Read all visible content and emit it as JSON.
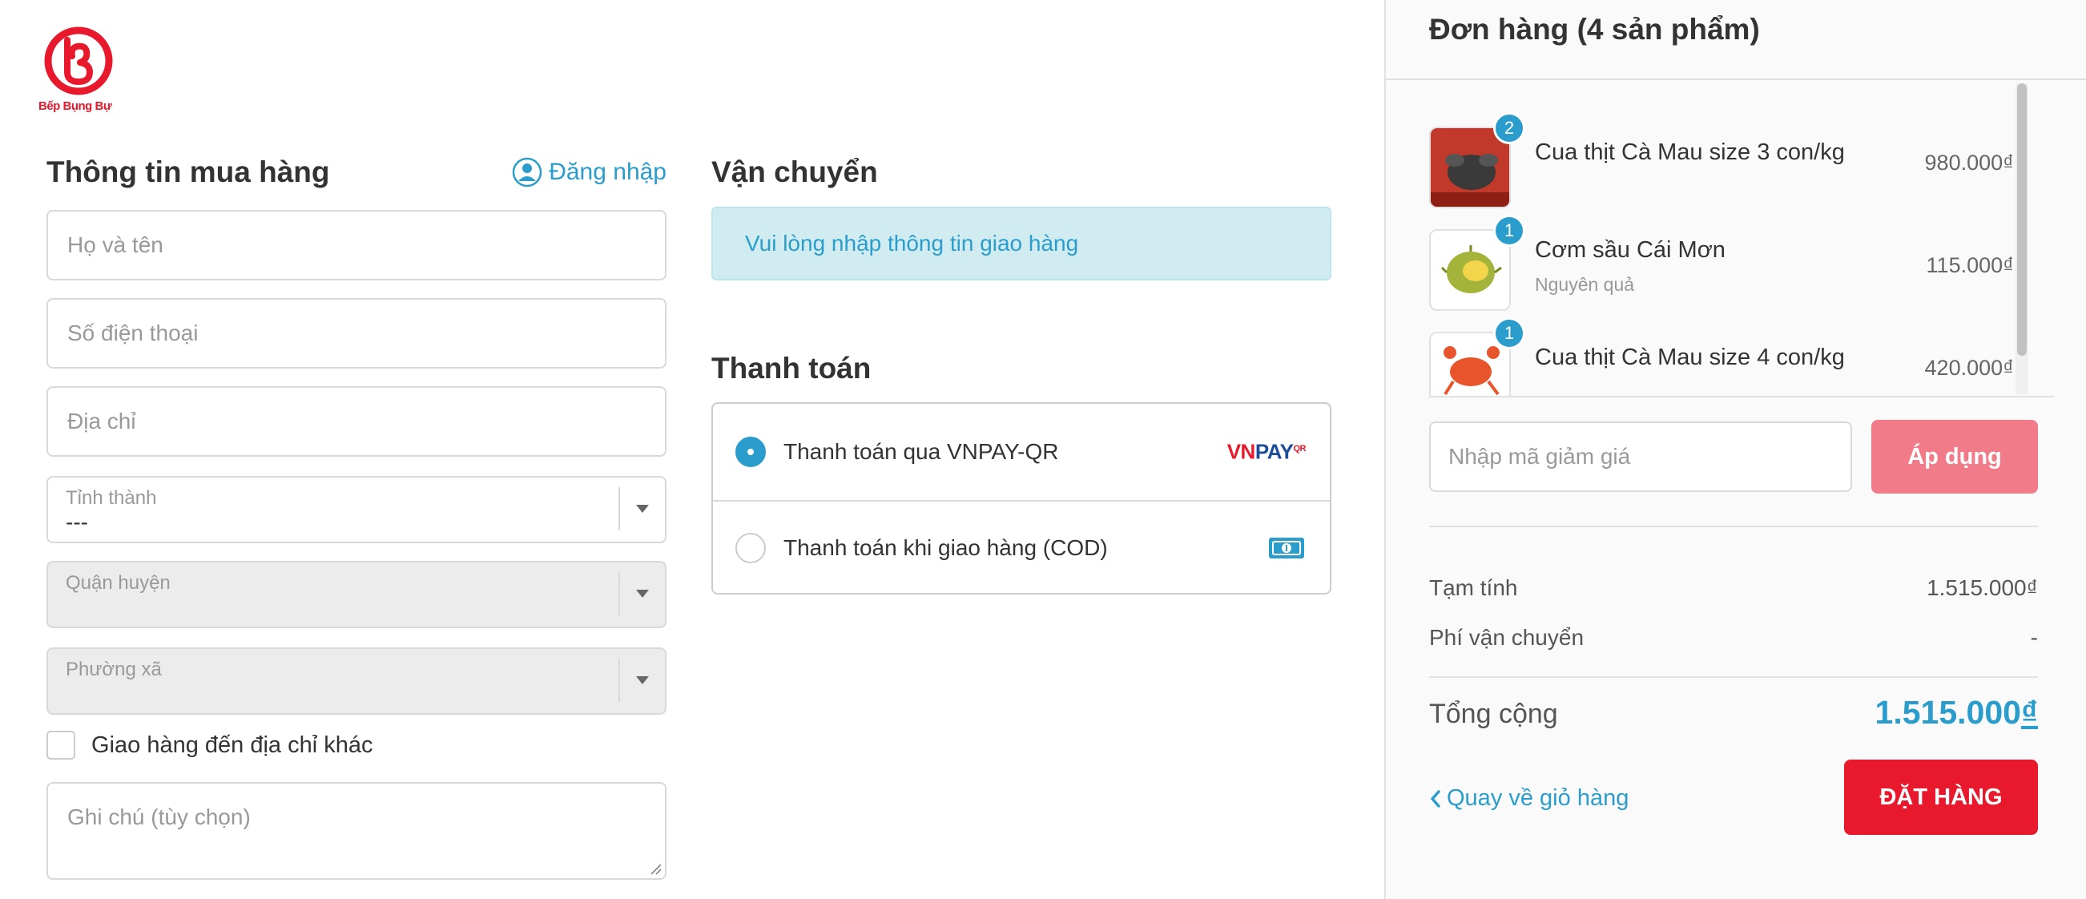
{
  "brand": {
    "logo_text": "Bếp Bụng Bự",
    "accent_color": "#e8192c",
    "link_color": "#2a9dcc"
  },
  "customer_info": {
    "title": "Thông tin mua hàng",
    "login_label": "Đăng nhập",
    "fullname_placeholder": "Họ và tên",
    "phone_placeholder": "Số điện thoại",
    "address_placeholder": "Địa chỉ",
    "province": {
      "label": "Tỉnh thành",
      "value": "---"
    },
    "district": {
      "label": "Quận huyện",
      "value": ""
    },
    "ward": {
      "label": "Phường xã",
      "value": ""
    },
    "ship_other_label": "Giao hàng đến địa chỉ khác",
    "note_placeholder": "Ghi chú (tùy chọn)"
  },
  "shipping": {
    "title": "Vận chuyển",
    "notice": "Vui lòng nhập thông tin giao hàng"
  },
  "payment": {
    "title": "Thanh toán",
    "methods": [
      {
        "label": "Thanh toán qua VNPAY-QR",
        "selected": true,
        "icon": "vnpay-logo"
      },
      {
        "label": "Thanh toán khi giao hàng (COD)",
        "selected": false,
        "icon": "cash-icon"
      }
    ],
    "vnpay_logo": {
      "part1": "VN",
      "part2": "PAY",
      "sup": "QR"
    }
  },
  "order": {
    "title": "Đơn hàng (4 sản phẩm)",
    "items": [
      {
        "qty": "2",
        "name": "Cua thịt Cà Mau size 3 con/kg",
        "variant": "",
        "price": "980.000₫"
      },
      {
        "qty": "1",
        "name": "Cơm sầu Cái Mơn",
        "variant": "Nguyên quả",
        "price": "115.000₫"
      },
      {
        "qty": "1",
        "name": "Cua thịt Cà Mau size 4 con/kg",
        "variant": "",
        "price": "420.000₫"
      }
    ],
    "discount_placeholder": "Nhập mã giảm giá",
    "apply_label": "Áp dụng",
    "subtotal_label": "Tạm tính",
    "subtotal_value": "1.515.000₫",
    "shipping_fee_label": "Phí vận chuyển",
    "shipping_fee_value": "-",
    "total_label": "Tổng cộng",
    "total_amount": "1.515.000",
    "total_currency": "₫",
    "back_label": "Quay về giỏ hàng",
    "place_order_label": "ĐẶT HÀNG"
  }
}
